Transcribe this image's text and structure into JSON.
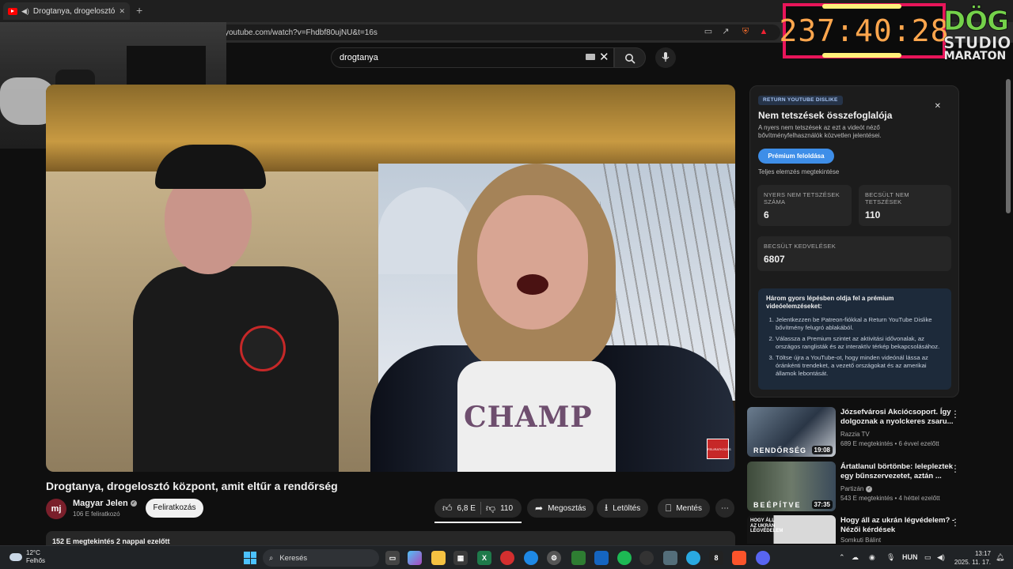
{
  "browser": {
    "tab_title": "Drogtanya, drogelosztó közp",
    "new_tab_symbol": "+",
    "close_symbol": "✕",
    "url": "youtube.com/watch?v=Fhdbf80ujNU&t=16s"
  },
  "overlay": {
    "timer": "237:40:28",
    "logo_line1": "DÖG",
    "logo_line2": "STUDIO",
    "logo_line3": "MARATON",
    "accent_color": "#e8155a",
    "timer_color": "#ffa64d"
  },
  "youtube": {
    "search_query": "drogtanya",
    "video": {
      "title": "Drogtanya, drogelosztó központ, amit eltűr a rendőrség",
      "shirt_text": "CHAMP",
      "badge_text": "FELIRATKOZÁS"
    },
    "channel": {
      "avatar_initials": "mj",
      "name": "Magyar Jelen",
      "subscribers": "106 E feliratkozó",
      "subscribe_label": "Feliratkozás"
    },
    "actions": {
      "like_count": "6,8 E",
      "dislike_count": "110",
      "share_label": "Megosztás",
      "download_label": "Letöltés",
      "save_label": "Mentés",
      "more_label": "⋯"
    },
    "description_preview": "152 E megtekintés  2 nappal ezelőtt"
  },
  "dislike_panel": {
    "badge": "RETURN YOUTUBE DISLIKE",
    "title": "Nem tetszések összefoglalója",
    "description": "A nyers nem tetszések az ezt a videót néző bővítményfelhasználók közvetlen jelentései.",
    "premium_button": "Prémium feloldása",
    "full_analysis": "Teljes elemzés megtekintése",
    "cards": [
      {
        "label": "NYERS NEM TETSZÉSEK SZÁMA",
        "value": "6"
      },
      {
        "label": "BECSÜLT NEM TETSZÉSEK",
        "value": "110"
      },
      {
        "label": "BECSÜLT KEDVELÉSEK",
        "value": "6807"
      }
    ],
    "info_heading": "Három gyors lépésben oldja fel a prémium videóelemzéseket:",
    "steps": [
      "Jelentkezzen be Patreon-fiókkal a Return YouTube Dislike bővítmény felugró ablakából.",
      "Válassza a Premium szintet az aktivitási idővonalak, az országos ranglisták és az interaktív térkép bekapcsolásához.",
      "Töltse újra a YouTube-ot, hogy minden videónál lássa az óránkénti trendeket, a vezető országokat és az amerikai államok lebontását."
    ]
  },
  "recommendations": [
    {
      "title": "Józsefvárosi Akciócsoport. Így dolgoznak a nyolckeres zsaru...",
      "channel": "Razzia TV",
      "meta": "689 E megtekintés • 6 évvel ezelőtt",
      "duration": "19:08",
      "thumb_label": "RENDŐRSÉG"
    },
    {
      "title": "Ártatlanul börtönbe: lelepleztek egy bűnszervezetet, aztán ...",
      "channel": "Partizán",
      "meta": "543 E megtekintés • 4 héttel ezelőtt",
      "duration": "37:35",
      "thumb_label": "BEÉPÍTVE"
    },
    {
      "title": "Hogy áll az ukrán légvédelem? - Nézői kérdések",
      "channel": "Somkuti Bálint",
      "meta": "",
      "duration": "",
      "thumb_label": "HOGY ÁLL AZ UKRÁN LÉGVÉDELEM"
    }
  ],
  "taskbar": {
    "temperature": "12°C",
    "weather": "Felhős",
    "search_placeholder": "Keresés",
    "language": "HUN",
    "time": "13:17",
    "date": "2025. 11. 17."
  }
}
